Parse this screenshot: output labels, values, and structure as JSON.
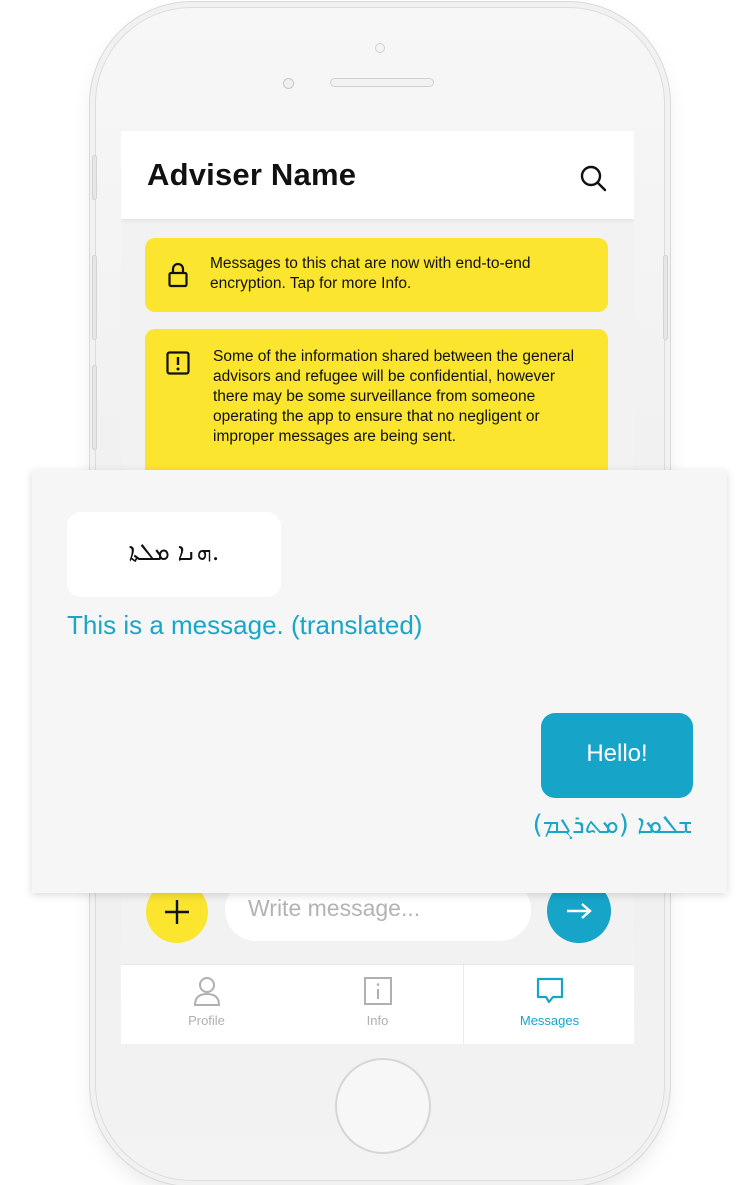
{
  "header": {
    "title": "Adviser Name"
  },
  "notices": {
    "encryption": "Messages to this chat are now with end-to-end encryption. Tap for more Info.",
    "privacy": "Some of the information shared between the general advisors  and refugee will be confidential, however there may be some surveillance from someone operating the app to ensure that no negligent or improper messages are being sent."
  },
  "messages": {
    "incoming_original": ".ܗܢܐ ܡܠܬܐ",
    "incoming_translated": "This is a message. (translated)",
    "outgoing_text": "Hello!",
    "outgoing_translated": "ܫܠܡܐ (ܡܬܪܓܡ)"
  },
  "composer": {
    "placeholder": "Write message..."
  },
  "tabs": [
    {
      "label": "Profile"
    },
    {
      "label": "Info"
    },
    {
      "label": "Messages"
    }
  ],
  "colors": {
    "accent": "#16a4c9",
    "notice": "#fbe52f",
    "inactive_tab": "#b0b0b0"
  },
  "icons": {
    "search": "search-icon",
    "lock": "lock-icon",
    "alert": "alert-icon",
    "plus": "plus-icon",
    "send": "arrow-right-icon",
    "profile": "person-icon",
    "info": "info-icon",
    "messages": "chat-bubble-icon"
  }
}
